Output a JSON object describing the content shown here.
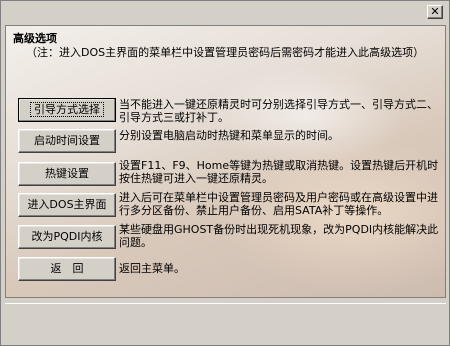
{
  "window": {
    "close_glyph": "✕"
  },
  "header": {
    "title": "高级选项",
    "subtitle": "（注：进入DOS主界面的菜单栏中设置管理员密码后需密码才能进入此高级选项）"
  },
  "options": [
    {
      "label": "引导方式选择",
      "desc": "当不能进入一键还原精灵时可分别选择引导方式一、引导方式二、引导方式三或打补丁。"
    },
    {
      "label": "启动时间设置",
      "desc": "分别设置电脑启动时热键和菜单显示的时间。"
    },
    {
      "label": "热键设置",
      "desc": "设置F11、F9、Home等键为热键或取消热键。设置热键后开机时按住热键可进入一键还原精灵。"
    },
    {
      "label": "进入DOS主界面",
      "desc": "进入后可在菜单栏中设置管理员密码及用户密码或在高级设置中进行多分区备份、禁止用户备份、启用SATA补丁等操作。"
    },
    {
      "label": "改为PQDI内核",
      "desc": "某些硬盘用GHOST备份时出现死机现象，改为PQDI内核能解决此问题。"
    },
    {
      "label": "返　回",
      "desc": "返回主菜单。"
    }
  ]
}
